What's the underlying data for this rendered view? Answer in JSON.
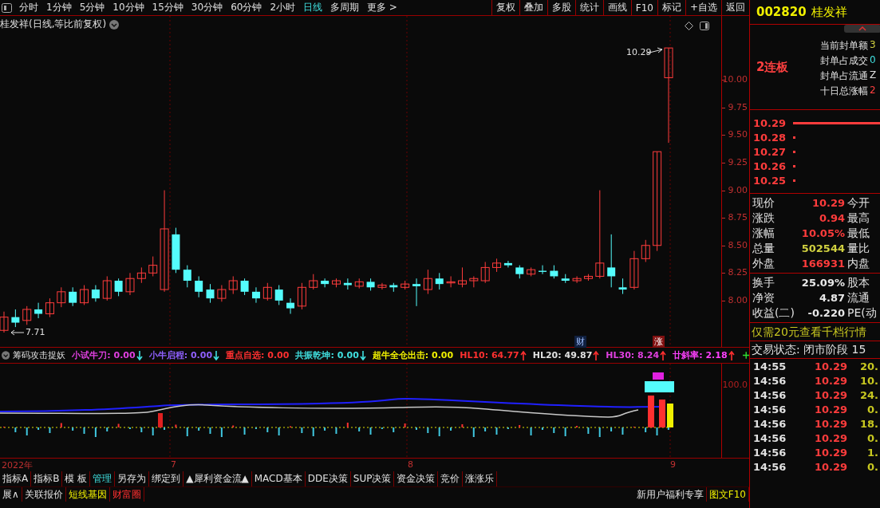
{
  "periods": [
    {
      "label": "分时",
      "selected": false
    },
    {
      "label": "1分钟",
      "selected": false
    },
    {
      "label": "5分钟",
      "selected": false
    },
    {
      "label": "10分钟",
      "selected": false
    },
    {
      "label": "15分钟",
      "selected": false
    },
    {
      "label": "30分钟",
      "selected": false
    },
    {
      "label": "60分钟",
      "selected": false
    },
    {
      "label": "2小时",
      "selected": false
    },
    {
      "label": "日线",
      "selected": true
    },
    {
      "label": "多周期",
      "selected": false
    },
    {
      "label": "更多 >",
      "selected": false
    }
  ],
  "toolbar": [
    "复权",
    "叠加",
    "多股",
    "统计",
    "画线",
    "F10",
    "标记",
    "+自选",
    "返回"
  ],
  "chart": {
    "title": "桂发祥(日线,等比前复权)",
    "high_label": "10.29",
    "low_label": "7.71",
    "markers": [
      {
        "text": "财",
        "kind": "finance"
      },
      {
        "text": "涨",
        "kind": "limit"
      }
    ],
    "chart_data": {
      "type": "candlestick",
      "ohlc": [
        [
          7.73,
          7.9,
          7.71,
          7.85
        ],
        [
          7.85,
          7.92,
          7.76,
          7.8
        ],
        [
          7.82,
          7.95,
          7.78,
          7.92
        ],
        [
          7.92,
          7.98,
          7.84,
          7.88
        ],
        [
          7.88,
          8.02,
          7.85,
          7.98
        ],
        [
          7.98,
          8.12,
          7.94,
          8.08
        ],
        [
          8.08,
          8.12,
          7.95,
          7.98
        ],
        [
          7.98,
          8.14,
          7.96,
          8.1
        ],
        [
          8.1,
          8.14,
          7.99,
          8.02
        ],
        [
          8.02,
          8.22,
          8.0,
          8.18
        ],
        [
          8.18,
          8.2,
          8.04,
          8.08
        ],
        [
          8.08,
          8.25,
          8.05,
          8.2
        ],
        [
          8.2,
          8.3,
          8.16,
          8.25
        ],
        [
          8.25,
          8.4,
          8.22,
          8.32
        ],
        [
          8.1,
          9.0,
          8.08,
          8.65
        ],
        [
          8.6,
          8.66,
          8.25,
          8.28
        ],
        [
          8.28,
          8.32,
          8.12,
          8.18
        ],
        [
          8.18,
          8.22,
          8.03,
          8.08
        ],
        [
          8.1,
          8.15,
          7.98,
          8.02
        ],
        [
          8.02,
          8.14,
          7.99,
          8.1
        ],
        [
          8.1,
          8.22,
          8.06,
          8.18
        ],
        [
          8.18,
          8.2,
          8.05,
          8.08
        ],
        [
          8.08,
          8.12,
          7.98,
          8.02
        ],
        [
          8.02,
          8.16,
          8.0,
          8.12
        ],
        [
          8.1,
          8.14,
          7.96,
          8.0
        ],
        [
          7.98,
          8.02,
          7.88,
          7.93
        ],
        [
          7.95,
          8.16,
          7.92,
          8.12
        ],
        [
          8.12,
          8.24,
          8.1,
          8.18
        ],
        [
          8.18,
          8.2,
          8.12,
          8.15
        ],
        [
          8.15,
          8.2,
          8.12,
          8.18
        ],
        [
          8.16,
          8.2,
          8.1,
          8.14
        ],
        [
          8.13,
          8.2,
          8.11,
          8.17
        ],
        [
          8.17,
          8.2,
          8.09,
          8.12
        ],
        [
          8.12,
          8.16,
          8.1,
          8.14
        ],
        [
          8.14,
          8.16,
          8.08,
          8.12
        ],
        [
          8.12,
          8.18,
          8.1,
          8.15
        ],
        [
          8.15,
          8.2,
          7.95,
          8.13
        ],
        [
          8.1,
          8.28,
          8.06,
          8.2
        ],
        [
          8.2,
          8.25,
          8.1,
          8.15
        ],
        [
          8.16,
          8.22,
          8.12,
          8.17
        ],
        [
          8.15,
          8.3,
          8.12,
          8.18
        ],
        [
          8.18,
          8.22,
          8.12,
          8.2
        ],
        [
          8.18,
          8.35,
          8.16,
          8.3
        ],
        [
          8.3,
          8.38,
          8.26,
          8.34
        ],
        [
          8.34,
          8.36,
          8.3,
          8.32
        ],
        [
          8.3,
          8.32,
          8.2,
          8.24
        ],
        [
          8.24,
          8.3,
          8.22,
          8.28
        ],
        [
          8.27,
          8.32,
          8.24,
          8.26
        ],
        [
          8.27,
          8.32,
          8.2,
          8.22
        ],
        [
          8.2,
          8.24,
          8.16,
          8.18
        ],
        [
          8.18,
          8.22,
          8.16,
          8.2
        ],
        [
          8.2,
          8.24,
          8.18,
          8.22
        ],
        [
          8.22,
          9.0,
          8.2,
          8.34
        ],
        [
          8.3,
          8.6,
          8.12,
          8.22
        ],
        [
          8.12,
          8.2,
          8.06,
          8.1
        ],
        [
          8.12,
          8.45,
          8.1,
          8.38
        ],
        [
          8.38,
          8.55,
          8.35,
          8.5
        ],
        [
          8.5,
          9.35,
          8.45,
          9.35
        ],
        [
          10.02,
          10.29,
          9.43,
          10.29
        ]
      ],
      "ylim": [
        7.58,
        10.58
      ],
      "yticks": [
        {
          "value": 10,
          "label": "10.00"
        },
        {
          "value": 9.75,
          "label": "9.75"
        },
        {
          "value": 9.5,
          "label": "9.50"
        },
        {
          "value": 9.25,
          "label": "9.25"
        },
        {
          "value": 9,
          "label": "9.00"
        },
        {
          "value": 8.75,
          "label": "8.75"
        },
        {
          "value": 8.5,
          "label": "8.50"
        },
        {
          "value": 8.25,
          "label": "8.25"
        },
        {
          "value": 8,
          "label": "8.00"
        }
      ]
    }
  },
  "indicator": {
    "name": "筹码攻击捉妖",
    "items": [
      {
        "label": "小试牛刀:",
        "value": "0.00",
        "rising": false,
        "color": "#e040e0"
      },
      {
        "label": "小牛启程:",
        "value": "0.00",
        "rising": false,
        "color": "#9060ff"
      },
      {
        "label": "重点自选:",
        "value": "0.00",
        "color": "#ff3030"
      },
      {
        "label": "共振乾坤:",
        "value": "0.00",
        "rising": false,
        "color": "#40e0e0"
      },
      {
        "label": "超牛全仓出击:",
        "value": "0.00",
        "color": "#f0f000"
      },
      {
        "label": "HL10:",
        "value": "64.77",
        "rising": true,
        "color": "#ff3030"
      },
      {
        "label": "HL20:",
        "value": "49.87",
        "rising": true,
        "color": "#e0e0e0"
      },
      {
        "label": "HL30:",
        "value": "8.24",
        "rising": true,
        "color": "#e040e0"
      },
      {
        "label": "廿斜率:",
        "value": "2.18",
        "rising": true,
        "color": "#ff40ff"
      }
    ],
    "axis_label": "100.0"
  },
  "dates": [
    "2022年",
    "7",
    "8",
    "9"
  ],
  "tabs_row1": [
    {
      "label": "指标A",
      "selected": false
    },
    {
      "label": "指标B",
      "selected": false
    },
    {
      "label": "模 板",
      "selected": false
    },
    {
      "label": "管理",
      "selected": true
    },
    {
      "label": "另存为",
      "selected": false
    },
    {
      "label": "绑定到",
      "selected": false
    },
    {
      "label": "▲犀利资金流▲",
      "selected": false
    },
    {
      "label": "MACD基本",
      "selected": false
    },
    {
      "label": "DDE决策",
      "selected": false
    },
    {
      "label": "SUP决策",
      "selected": false
    },
    {
      "label": "资金决策",
      "selected": false
    },
    {
      "label": "竞价",
      "selected": false
    },
    {
      "label": "涨涨乐",
      "selected": false
    }
  ],
  "tabs_row2": [
    {
      "label": "展∧",
      "kind": "plain"
    },
    {
      "label": "关联报价",
      "kind": "plain"
    },
    {
      "label": "短线基因",
      "kind": "highlight"
    },
    {
      "label": "财富圈",
      "kind": "alert"
    }
  ],
  "promo": [
    {
      "label": "新用户福利专享",
      "kind": "plain"
    },
    {
      "label": "图文F10",
      "kind": "highlight"
    }
  ],
  "stock": {
    "code": "002820",
    "name": "桂发祥",
    "streak": "2连板",
    "seal": [
      {
        "label": "当前封单额",
        "value": "3",
        "color": "#d0d040"
      },
      {
        "label": "封单占成交",
        "value": "0",
        "color": "#40e0e0"
      },
      {
        "label": "封单占流通",
        "value": "Z",
        "color": "#e0e0e0"
      },
      {
        "label": "十日总涨幅",
        "value": "2",
        "color": "#ff4040"
      }
    ]
  },
  "ladder": [
    {
      "price": "10.29",
      "kind": "bar"
    },
    {
      "price": "10.28",
      "kind": "dot"
    },
    {
      "price": "10.27",
      "kind": "dot"
    },
    {
      "price": "10.26",
      "kind": "dot"
    },
    {
      "price": "10.25",
      "kind": "dot"
    }
  ],
  "quote": [
    [
      {
        "label": "现价",
        "value": "10.29",
        "color": "#ff3c3c",
        "label2": "今开"
      },
      {
        "label": "涨跌",
        "value": "0.94",
        "color": "#ff3c3c",
        "label2": "最高"
      },
      {
        "label": "涨幅",
        "value": "10.05%",
        "color": "#ff3c3c",
        "label2": "最低"
      },
      {
        "label": "总量",
        "value": "502544",
        "color": "#d0d040",
        "label2": "量比"
      },
      {
        "label": "外盘",
        "value": "166931",
        "color": "#ff3c3c",
        "label2": "内盘"
      }
    ],
    [
      {
        "label": "换手",
        "value": "25.09%",
        "color": "#e8e8e8",
        "label2": "股本"
      },
      {
        "label": "净资",
        "value": "4.87",
        "color": "#e8e8e8",
        "label2": "流通"
      },
      {
        "label": "收益(二)",
        "value": "-0.220",
        "color": "#e8e8e8",
        "label2": "PE(动"
      }
    ]
  ],
  "ad": "仅需20元查看千档行情",
  "status": "交易状态: 闭市阶段 15",
  "trades": [
    {
      "time": "14:55",
      "price": "10.29",
      "volume": "20."
    },
    {
      "time": "14:56",
      "price": "10.29",
      "volume": "10."
    },
    {
      "time": "14:56",
      "price": "10.29",
      "volume": "24."
    },
    {
      "time": "14:56",
      "price": "10.29",
      "volume": "0."
    },
    {
      "time": "14:56",
      "price": "10.29",
      "volume": "18."
    },
    {
      "time": "14:56",
      "price": "10.29",
      "volume": "0."
    },
    {
      "time": "14:56",
      "price": "10.29",
      "volume": "1."
    },
    {
      "time": "14:56",
      "price": "10.29",
      "volume": "0."
    }
  ]
}
